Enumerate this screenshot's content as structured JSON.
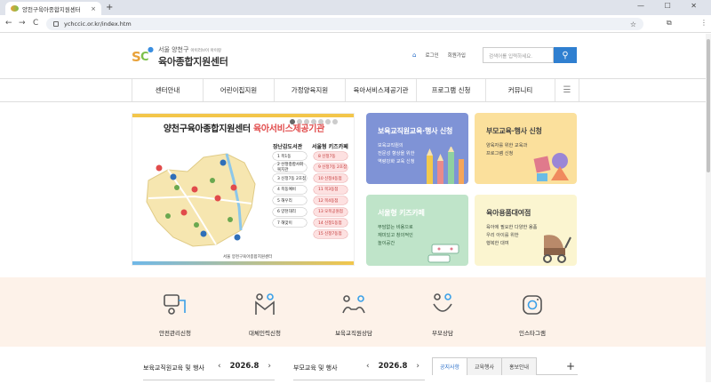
{
  "browser": {
    "tab_title": "양천구육아종합지원센터",
    "tab_close": "×",
    "new_tab": "+",
    "url": "ychccic.or.kr/index.htm",
    "back": "←",
    "forward": "→",
    "reload": "C",
    "star": "☆",
    "extensions": "⧉",
    "window_controls": "— ☐ ✕",
    "menu": "⋮"
  },
  "header": {
    "logo_sub": "서울 양천구",
    "logo_sub_small": "아이러브이 아이랑",
    "logo_title": "육아종합지원센터",
    "home": "⌂",
    "login": "로그인",
    "signup": "회원가입",
    "search_placeholder": "검색어를 입력하세요.",
    "search_icon": "⚲"
  },
  "gnb": [
    {
      "label": "센터안내"
    },
    {
      "label": "어린이집지원"
    },
    {
      "label": "가정양육지원"
    },
    {
      "label": "육아서비스제공기관"
    },
    {
      "label": "프로그램 신청"
    },
    {
      "label": "커뮤니티"
    }
  ],
  "gnb_menu_icon": "☰",
  "banner": {
    "title_a": "양천구육아종합지원센터",
    "title_b": "육아서비스제공기관",
    "col1": "장난감도서관",
    "col2": "서울형 키즈카페",
    "left": [
      "1 목1동",
      "2 신정종합사회복지관",
      "3 신정7동 2호점",
      "4 목동예비",
      "5 해우리",
      "6 양천대리",
      "7 해맞이"
    ],
    "right": [
      "8 신정7동",
      "9 신정7동 2호점",
      "10 신정4동점",
      "11 목3동점",
      "12 목4동점",
      "13 오목공원점",
      "14 신정1동점",
      "15 신정7동점"
    ],
    "caption": "서울 양천구육아종합지원센터",
    "slides": 7,
    "active_slide": 1
  },
  "cards": [
    {
      "title": "보육교직원교육·행사 신청",
      "text": "보육교직원의\n전문성 향상을 위한\n역량강화 교육 신청",
      "bg": "#7f93d6"
    },
    {
      "title": "부모교육·행사 신청",
      "text": "양육자를 위한 교육과\n프로그램 신청",
      "bg": "#fbe09c"
    },
    {
      "title": "서울형 키즈카페",
      "text": "부담없는 비용으로\n재미있고 창의적인\n놀이공간",
      "bg": "#bfe4c9"
    },
    {
      "title": "육아용품대여점",
      "text": "육아에 필요한 다양한 용품\n우리 아이를 위한\n행복한 대여",
      "bg": "#fbf5d0"
    }
  ],
  "quick": [
    {
      "label": "안전관리신청"
    },
    {
      "label": "대체인력신청"
    },
    {
      "label": "보육교직원상담"
    },
    {
      "label": "부모상담"
    },
    {
      "label": "인스타그램"
    }
  ],
  "calendar1": {
    "title": "보육교직원교육 및 행사",
    "month": "2026.8",
    "prev": "‹",
    "next": "›"
  },
  "calendar2": {
    "title": "부모교육 및 행사",
    "month": "2026.8",
    "prev": "‹",
    "next": "›"
  },
  "notice_tabs": [
    {
      "label": "공지사항"
    },
    {
      "label": "교육행사"
    },
    {
      "label": "홍보안내"
    }
  ],
  "notice_plus": "+",
  "colors": {
    "accent": "#2f7fd0",
    "quick_bg": "#fdf2e9",
    "title_red": "#e14b4b"
  }
}
